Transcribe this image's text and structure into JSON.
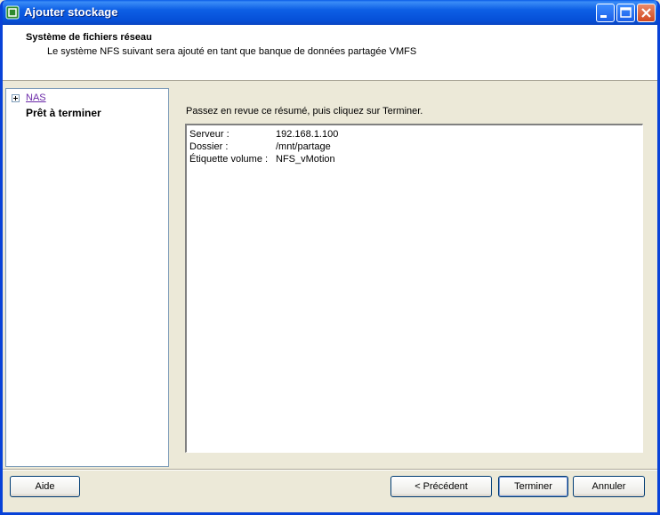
{
  "window": {
    "title": "Ajouter stockage"
  },
  "header": {
    "title": "Système de fichiers réseau",
    "subtitle": "Le système NFS suivant sera ajouté en tant que banque de données partagée VMFS"
  },
  "nav": {
    "items": [
      {
        "label": "NAS"
      },
      {
        "label": "Prêt à terminer"
      }
    ]
  },
  "main": {
    "instruction": "Passez en revue ce résumé, puis cliquez sur Terminer.",
    "summary": [
      {
        "key": "Serveur :",
        "value": "192.168.1.100"
      },
      {
        "key": "Dossier :",
        "value": "/mnt/partage"
      },
      {
        "key": "Étiquette volume :",
        "value": "NFS_vMotion"
      }
    ]
  },
  "buttons": {
    "help": "Aide",
    "back": "< Précédent",
    "finish": "Terminer",
    "cancel": "Annuler"
  },
  "colors": {
    "titlebar": "#0a5ce8",
    "visited_link": "#6b29a8",
    "dialog_bg": "#ece9d8"
  }
}
